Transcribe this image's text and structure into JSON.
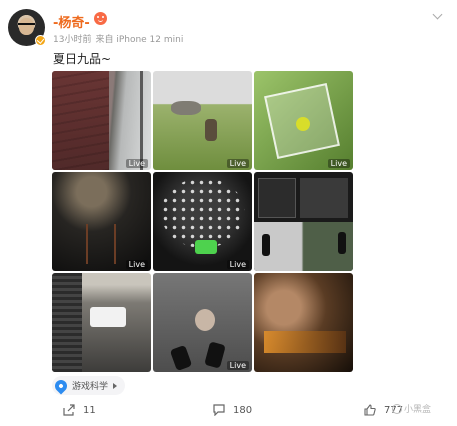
{
  "header": {
    "username": "-杨奇-",
    "time": "13小时前",
    "source": "来自 iPhone 12 mini",
    "vip_icon": "smiley-badge-icon",
    "verified_icon": "verified-badge-icon"
  },
  "post": {
    "text": "夏日九品~"
  },
  "grid": {
    "live_label": "Live",
    "images": [
      {
        "name": "tiled-walkway-photo",
        "live": true
      },
      {
        "name": "grass-hill-figure-photo",
        "live": true
      },
      {
        "name": "acrylic-box-photo",
        "live": true
      },
      {
        "name": "dark-tripod-photo",
        "live": true
      },
      {
        "name": "light-dome-photo",
        "live": true
      },
      {
        "name": "motion-capture-screens-photo",
        "live": false
      },
      {
        "name": "bench-cushion-photo",
        "live": false
      },
      {
        "name": "doll-floor-photo",
        "live": true
      },
      {
        "name": "warm-light-closeup-photo",
        "live": false
      }
    ]
  },
  "location": {
    "label": "游戏科学"
  },
  "actions": {
    "share_count": "11",
    "comment_count": "180",
    "like_count": "777"
  },
  "watermark": {
    "text": "小黑盒"
  }
}
